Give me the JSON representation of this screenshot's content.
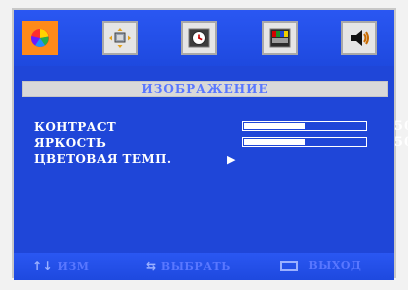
{
  "top_tabs": [
    {
      "name": "color-wheel-icon",
      "selected": true
    },
    {
      "name": "display-position-icon",
      "selected": false
    },
    {
      "name": "clock-icon",
      "selected": false
    },
    {
      "name": "color-bars-icon",
      "selected": false
    },
    {
      "name": "speaker-icon",
      "selected": false
    }
  ],
  "section_title": "ИЗОБРАЖЕНИЕ",
  "settings": {
    "contrast": {
      "label": "КОНТРАСТ",
      "value": "50",
      "level": 0.5
    },
    "brightness": {
      "label": "ЯРКОСТЬ",
      "value": "50",
      "level": 0.5
    },
    "color_temp": {
      "label": "ЦВЕТОВАЯ ТЕМП.",
      "arrow": "▶"
    }
  },
  "footer": {
    "change_icon": "↑↓",
    "change_label": "ИЗМ",
    "select_icon": "⇆",
    "select_label": "ВЫБРАТЬ",
    "exit_label": "ВЫХОД"
  },
  "colors": {
    "osd_blue": "#1f46d8",
    "title_bar": "#d9d9d9",
    "highlight_orange": "#ff8a1a",
    "label_blue": "#5977ff",
    "text_white": "#ffffff"
  }
}
